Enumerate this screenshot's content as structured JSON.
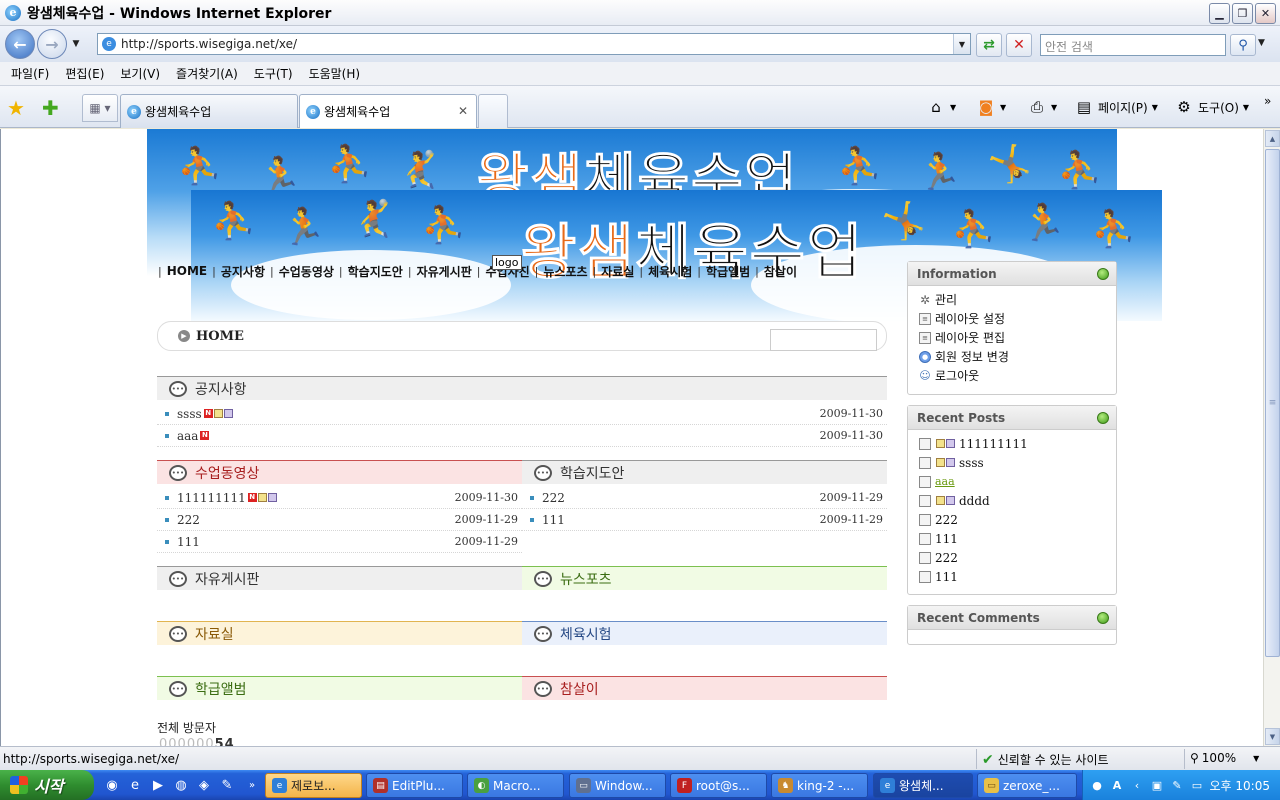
{
  "window": {
    "title": "왕샘체육수업 - Windows Internet Explorer"
  },
  "address": {
    "url": "http://sports.wisegiga.net/xe/",
    "search_placeholder": "안전 검색"
  },
  "menu": [
    "파일(F)",
    "편집(E)",
    "보기(V)",
    "즐겨찾기(A)",
    "도구(T)",
    "도움말(H)"
  ],
  "tabs": [
    {
      "label": "왕샘체육수업"
    },
    {
      "label": "왕샘체육수업"
    }
  ],
  "command_bar": {
    "page_label": "페이지(P)",
    "tools_label": "도구(O)"
  },
  "site": {
    "title_orange": "왕샘",
    "title_black": "체육수업",
    "logo_tooltip": "logo",
    "nav": [
      "HOME",
      "공지사항",
      "수업동영상",
      "학습지도안",
      "자유게시판",
      "수업사진",
      "뉴스포츠",
      "자료실",
      "체육시험",
      "학급앨범",
      "참살이"
    ],
    "location": "HOME",
    "sections": {
      "notice": {
        "title": "공지사항",
        "rows": [
          {
            "title": "ssss",
            "date": "2009-11-30"
          },
          {
            "title": "aaa",
            "date": "2009-11-30"
          }
        ]
      },
      "video": {
        "title": "수업동영상",
        "rows": [
          {
            "title": "111111111",
            "date": "2009-11-30"
          },
          {
            "title": "222",
            "date": "2009-11-29"
          },
          {
            "title": "111",
            "date": "2009-11-29"
          }
        ]
      },
      "plan": {
        "title": "학습지도안",
        "rows": [
          {
            "title": "222",
            "date": "2009-11-29"
          },
          {
            "title": "111",
            "date": "2009-11-29"
          }
        ]
      },
      "free": {
        "title": "자유게시판"
      },
      "newsports": {
        "title": "뉴스포츠"
      },
      "library": {
        "title": "자료실"
      },
      "exam": {
        "title": "체육시험"
      },
      "album": {
        "title": "학급앨범"
      },
      "wellbeing": {
        "title": "참살이"
      }
    },
    "visit_label": "전체 방문자",
    "counter_faded": "000000",
    "counter_value": "54"
  },
  "sidebar": {
    "info": {
      "title": "Information",
      "items": [
        "관리",
        "레이아웃 설정",
        "레이아웃 편집",
        "회원 정보 변경",
        "로그아웃"
      ]
    },
    "recent_posts": {
      "title": "Recent Posts",
      "items": [
        "111111111",
        "ssss",
        "aaa",
        "dddd",
        "222",
        "111",
        "222",
        "111"
      ]
    },
    "recent_comments": {
      "title": "Recent Comments"
    }
  },
  "status": {
    "url": "http://sports.wisegiga.net/xe/",
    "trust": "신뢰할 수 있는 사이트",
    "zoom": "100%"
  },
  "taskbar": {
    "start": "시작",
    "buttons": [
      "제로보...",
      "EditPlu...",
      "Macro...",
      "Window...",
      "root@s...",
      "king-2 -...",
      "왕샘체...",
      "zeroxe_..."
    ],
    "clock": "오후 10:05"
  },
  "colors": {
    "accent_orange": "#e86a18",
    "widget_dot": "#3e9a18",
    "taskbar_blue": "#2156d0"
  }
}
